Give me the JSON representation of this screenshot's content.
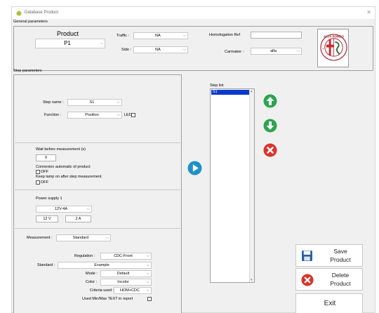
{
  "window": {
    "title": "Database Product"
  },
  "general": {
    "section_label": "General parameters",
    "product_label": "Product",
    "product_value": "P1",
    "traffic_label": "Traffic :",
    "traffic_value": "NA",
    "side_label": "Side :",
    "side_value": "NA",
    "homologation_label": "Homologation Ref",
    "homologation_value": "",
    "carmaker_label": "Carmaker :",
    "carmaker_value": "alfa"
  },
  "step": {
    "section_label": "Step parameters",
    "step_name_label": "Step name :",
    "step_name_value": "S1",
    "function_label": "Function :",
    "function_value": "Position",
    "led_label": "LED",
    "wait_label": "Wait before measurement (s)",
    "wait_value": "0",
    "connexion_label": "Connexion automatic of product",
    "connexion_state": "OFF",
    "keep_lamp_label": "Keep lamp on after step measurement",
    "keep_lamp_state": "OFF",
    "power_label": "Power supply 1",
    "power_value": "12V-4A",
    "voltage_value": "12 V",
    "current_value": "2 A",
    "measurement_label": "Measurement :",
    "measurement_value": "Standard",
    "regulation_label": "Regulation :",
    "regulation_value": "CDC-Front",
    "standard_label": "Standard :",
    "standard_value": "Example",
    "mode_label": "Mode :",
    "mode_value": "Default",
    "color_label": "Color :",
    "color_value": "Incolor",
    "criteria_label": "Criteria used :",
    "criteria_value": "HOM+CDC",
    "minmax_label": "Used Min/Max TEXT in report"
  },
  "step_list": {
    "label": "Step list",
    "items": [
      "S1"
    ]
  },
  "buttons": {
    "save_line1": "Save",
    "save_line2": "Product",
    "delete_line1": "Delete",
    "delete_line2": "Product",
    "exit": "Exit"
  },
  "colors": {
    "accent_blue": "#1e90c8",
    "green": "#2da44e",
    "red": "#d9342b",
    "selection": "#0a39c9"
  }
}
